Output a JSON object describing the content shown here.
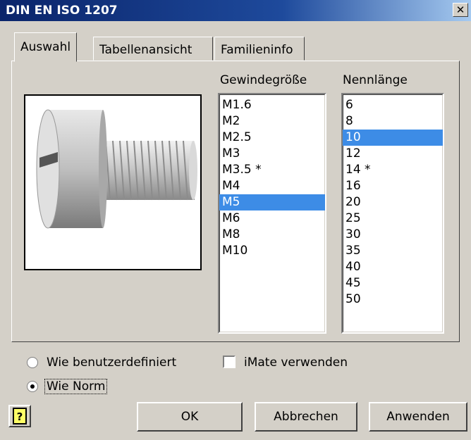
{
  "window": {
    "title": "DIN EN ISO 1207",
    "close_glyph": "✕"
  },
  "tabs": [
    {
      "label": "Auswahl",
      "active": true
    },
    {
      "label": "Tabellenansicht",
      "active": false
    },
    {
      "label": "Familieninfo",
      "active": false
    }
  ],
  "preview": {
    "icon": "slotted-cheese-head-screw-image"
  },
  "thread_size": {
    "header": "Gewindegröße",
    "items": [
      "M1.6",
      "M2",
      "M2.5",
      "M3",
      "M3.5 *",
      "M4",
      "M5",
      "M6",
      "M8",
      "M10"
    ],
    "selected": "M5"
  },
  "nominal_length": {
    "header": "Nennlänge",
    "items": [
      "6",
      "8",
      "10",
      "12",
      "14 *",
      "16",
      "20",
      "25",
      "30",
      "35",
      "40",
      "45",
      "50"
    ],
    "selected": "10"
  },
  "options": {
    "radio_user_defined": {
      "label": "Wie benutzerdefiniert",
      "checked": false
    },
    "radio_standard": {
      "label": "Wie Norm",
      "checked": true
    },
    "imate": {
      "label": "iMate verwenden",
      "checked": false
    }
  },
  "buttons": {
    "help": "?",
    "ok": "OK",
    "cancel": "Abbrechen",
    "apply": "Anwenden"
  },
  "colors": {
    "selection": "#3d8ce6",
    "titlebar": "#0a246a",
    "face": "#d4d0c8"
  }
}
